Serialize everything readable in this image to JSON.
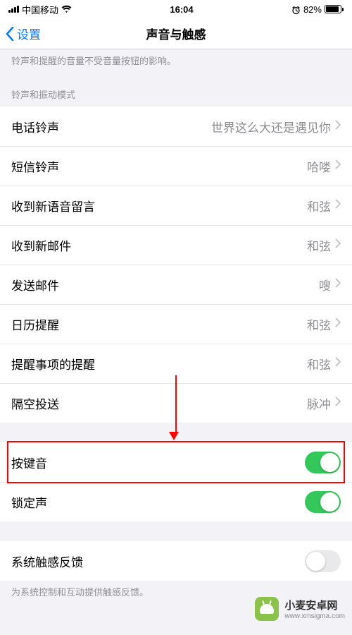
{
  "status": {
    "carrier": "中国移动",
    "time": "16:04",
    "battery_pct": "82%"
  },
  "nav": {
    "back_label": "设置",
    "title": "声音与触感"
  },
  "notes": {
    "volume_note": "铃声和提醒的音量不受音量按钮的影响。",
    "haptic_note": "为系统控制和互动提供触感反馈。"
  },
  "section_headers": {
    "patterns": "铃声和振动模式"
  },
  "rows": {
    "ringtone": {
      "label": "电话铃声",
      "value": "世界这么大还是遇见你"
    },
    "text_tone": {
      "label": "短信铃声",
      "value": "哈喽"
    },
    "voicemail": {
      "label": "收到新语音留言",
      "value": "和弦"
    },
    "new_mail": {
      "label": "收到新邮件",
      "value": "和弦"
    },
    "sent_mail": {
      "label": "发送邮件",
      "value": "嗖"
    },
    "calendar": {
      "label": "日历提醒",
      "value": "和弦"
    },
    "reminders": {
      "label": "提醒事项的提醒",
      "value": "和弦"
    },
    "airdrop": {
      "label": "隔空投送",
      "value": "脉冲"
    }
  },
  "toggles": {
    "key_clicks": {
      "label": "按键音",
      "on": true
    },
    "lock_sound": {
      "label": "锁定声",
      "on": true
    },
    "system_haptics": {
      "label": "系统触感反馈",
      "on": false
    }
  },
  "watermark": {
    "title": "小麦安卓网",
    "url": "www.xmsigma.com"
  }
}
